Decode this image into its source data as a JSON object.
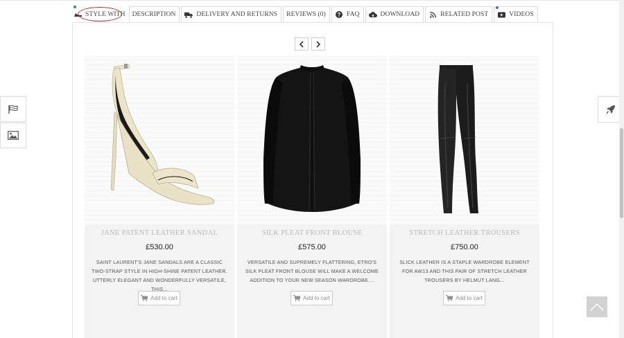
{
  "tabs": [
    {
      "label": "STYLE WITH",
      "icon": "shoe-icon",
      "active": true
    },
    {
      "label": "DESCRIPTION",
      "icon": "",
      "active": false
    },
    {
      "label": "DELIVERY AND RETURNS",
      "icon": "truck-icon",
      "active": false
    },
    {
      "label": "REVIEWS (0)",
      "icon": "",
      "active": false
    },
    {
      "label": "FAQ",
      "icon": "question-icon",
      "active": false
    },
    {
      "label": "DOWNLOAD",
      "icon": "cloud-download-icon",
      "active": false
    },
    {
      "label": "RELATED POST",
      "icon": "rss-icon",
      "active": false
    },
    {
      "label": "VIDEOS",
      "icon": "video-icon",
      "active": false
    }
  ],
  "carousel": {
    "prev_icon": "chevron-left-icon",
    "next_icon": "chevron-right-icon"
  },
  "products": [
    {
      "name": "JANE PATENT LEATHER SANDAL",
      "price": "£530.00",
      "description": "SAINT LAURENT'S JANE SANDALS ARE A CLASSIC TWO-STRAP STYLE IN HIGH-SHINE PATENT LEATHER. UTTERLY ELEGANT AND WONDERFULLY VERSATILE, THIS...",
      "cart_label": "Add to cart",
      "image": "sandal-image"
    },
    {
      "name": "SILK PLEAT FRONT BLOUSE",
      "price": "£575.00",
      "description": "VERSATILE AND SUPREMELY FLATTERING, ETRO'S SILK PLEAT FRONT BLOUSE WILL MAKE A WELCOME ADDITION TO YOUR NEW SEASON WARDROBE....",
      "cart_label": "Add to cart",
      "image": "blouse-image"
    },
    {
      "name": "STRETCH LEATHER TROUSERS",
      "price": "£750.00",
      "description": "SLICK LEATHER IS A STAPLE WARDROBE ELEMENT FOR AW13 AND THIS PAIR OF STRETCH LEATHER TROUSERS BY HELMUT LANG...",
      "cart_label": "Add to cart",
      "image": "trousers-image"
    }
  ],
  "widgets": {
    "left": [
      "flag-icon",
      "image-icon"
    ],
    "right": [
      "rocket-icon"
    ],
    "back_to_top": "chevron-up-icon"
  },
  "colors": {
    "highlight_oval": "#d6262a",
    "notification_dot": "#3c76d8",
    "product_name": "#b9b9b9"
  }
}
